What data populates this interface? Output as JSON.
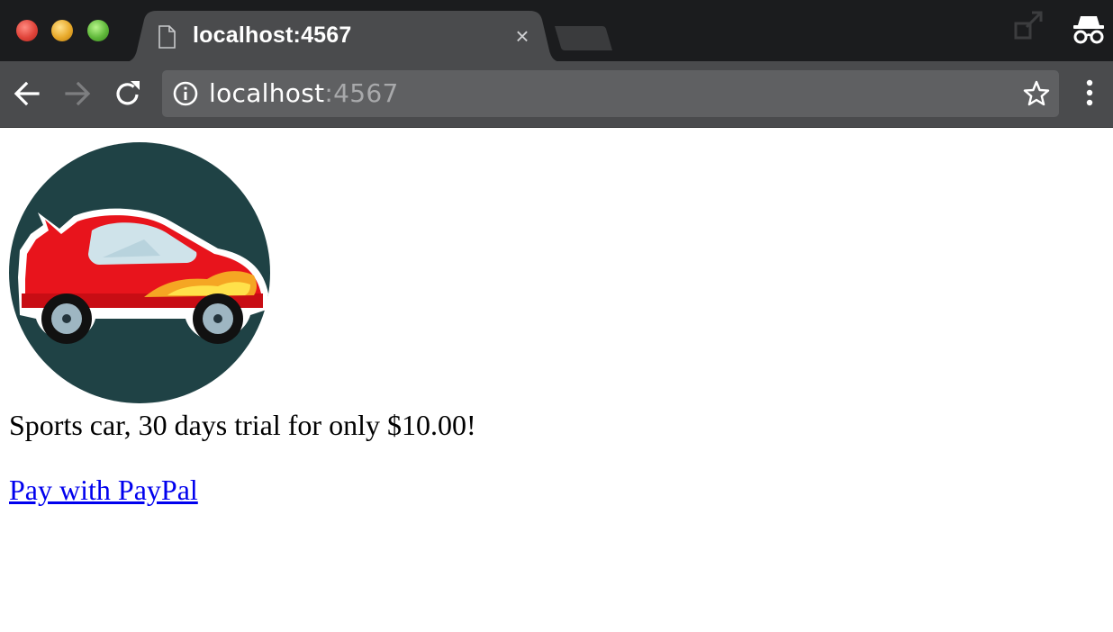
{
  "browser": {
    "tab": {
      "title": "localhost:4567",
      "close_glyph": "×"
    },
    "address_bar": {
      "host": "localhost",
      "port": ":4567"
    },
    "icons": {
      "window_close": "traffic-light-red",
      "window_minimize": "traffic-light-yellow",
      "window_maximize": "traffic-light-green",
      "tab_page": "document-icon",
      "back": "arrow-left-icon",
      "forward": "arrow-right-icon",
      "reload": "reload-icon",
      "site_info": "info-icon",
      "bookmark": "star-icon",
      "menu": "three-dots-vertical-icon",
      "cast": "cast-icon",
      "incognito": "incognito-icon"
    },
    "colors": {
      "tabstrip": "#1b1c1e",
      "toolbar": "#4a4b4d",
      "omnibox": "#5f6062",
      "active_tab": "#4a4b4d"
    }
  },
  "page": {
    "product": {
      "image": "sports-car-illustration",
      "description": "Sports car, 30 days trial for only $10.00!"
    },
    "payment_link": {
      "label": "Pay with PayPal"
    },
    "colors": {
      "image_circle": "#1f4245",
      "car_body": "#e8141c",
      "link": "#0000ee"
    }
  }
}
